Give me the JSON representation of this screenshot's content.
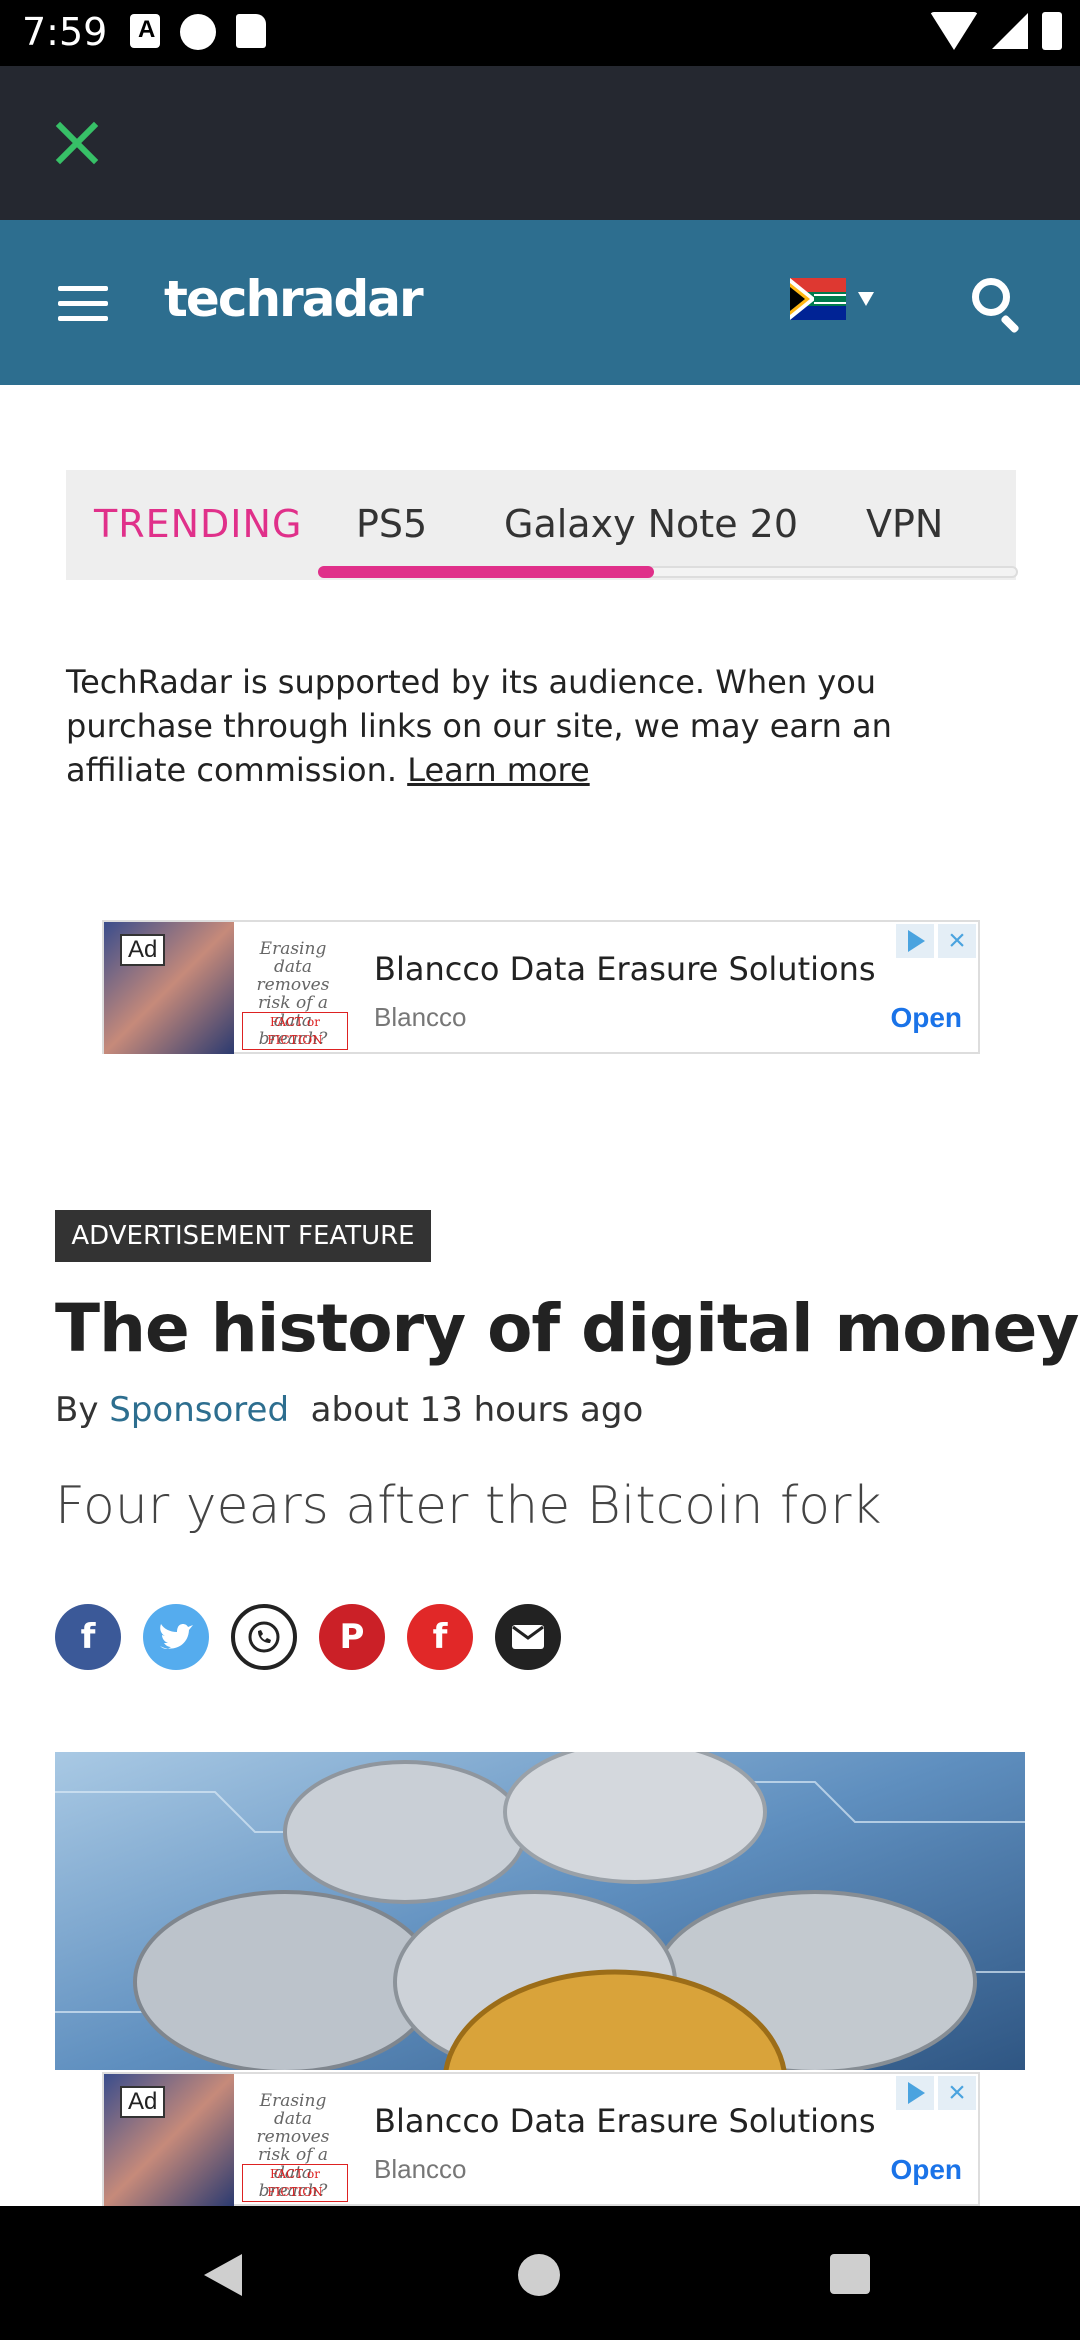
{
  "status": {
    "time": "7:59"
  },
  "header": {
    "logo": "techradar"
  },
  "trending": {
    "label": "TRENDING",
    "items": [
      "PS5",
      "Galaxy Note 20",
      "VPN"
    ]
  },
  "disclaimer": {
    "text": "TechRadar is supported by its audience. When you purchase through links on our site, we may earn an affiliate commission. ",
    "link": "Learn more"
  },
  "ads": [
    {
      "badge": "Ad",
      "promo": "Erasing data removes risk of a data breach?",
      "promo_tag": "FACT or FICTION",
      "title": "Blancco Data Erasure Solutions",
      "advertiser": "Blancco",
      "cta": "Open"
    },
    {
      "badge": "Ad",
      "promo": "Erasing data removes risk of a data breach?",
      "promo_tag": "FACT or FICTION",
      "title": "Blancco Data Erasure Solutions",
      "advertiser": "Blancco",
      "cta": "Open"
    }
  ],
  "article": {
    "tag": "ADVERTISEMENT FEATURE",
    "headline": "The history of digital money",
    "by": "By",
    "author": "Sponsored",
    "time": "about 13 hours ago",
    "subhead": "Four years after the Bitcoin fork"
  },
  "share": {
    "facebook": "f",
    "pinterest": "P",
    "flipboard": "f"
  },
  "colors": {
    "header": "#2d6e8f",
    "accent": "#e0308a",
    "close": "#37c067"
  }
}
